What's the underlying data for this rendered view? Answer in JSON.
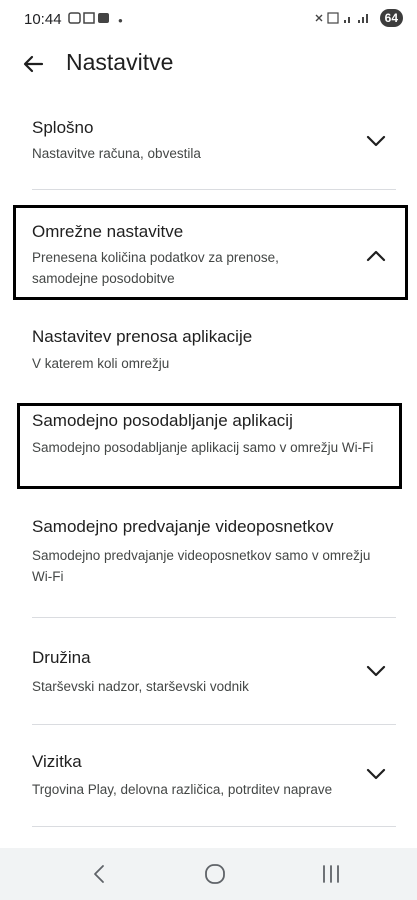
{
  "status_bar": {
    "time": "10:44",
    "battery": "64"
  },
  "header": {
    "title": "Nastavitve"
  },
  "sections": [
    {
      "title": "Splošno",
      "subtitle": "Nastavitve računa, obvestila"
    },
    {
      "title": "Omrežne nastavitve",
      "subtitle": "Prenesena količina podatkov za prenose, samodejne posodobitve"
    },
    {
      "title": "Nastavitev prenosa aplikacije",
      "subtitle": "V katerem koli omrežju"
    },
    {
      "title": "Samodejno posodabljanje aplikacij",
      "subtitle": "Samodejno posodabljanje aplikacij samo v omrežju Wi-Fi"
    },
    {
      "title": "Samodejno predvajanje videoposnetkov",
      "subtitle": "Samodejno predvajanje videoposnetkov samo v omrežju Wi-Fi"
    },
    {
      "title": "Družina",
      "subtitle": "Starševski nadzor, starševski vodnik"
    },
    {
      "title": "Vizitka",
      "subtitle": "Trgovina Play, delovna različica, potrditev naprave"
    }
  ],
  "icons": {
    "back": "arrow-left-icon",
    "expand": "chevron-down-icon",
    "collapse": "chevron-up-icon",
    "nav_back": "nav-back-icon",
    "nav_home": "nav-home-icon",
    "nav_recents": "nav-recents-icon"
  }
}
